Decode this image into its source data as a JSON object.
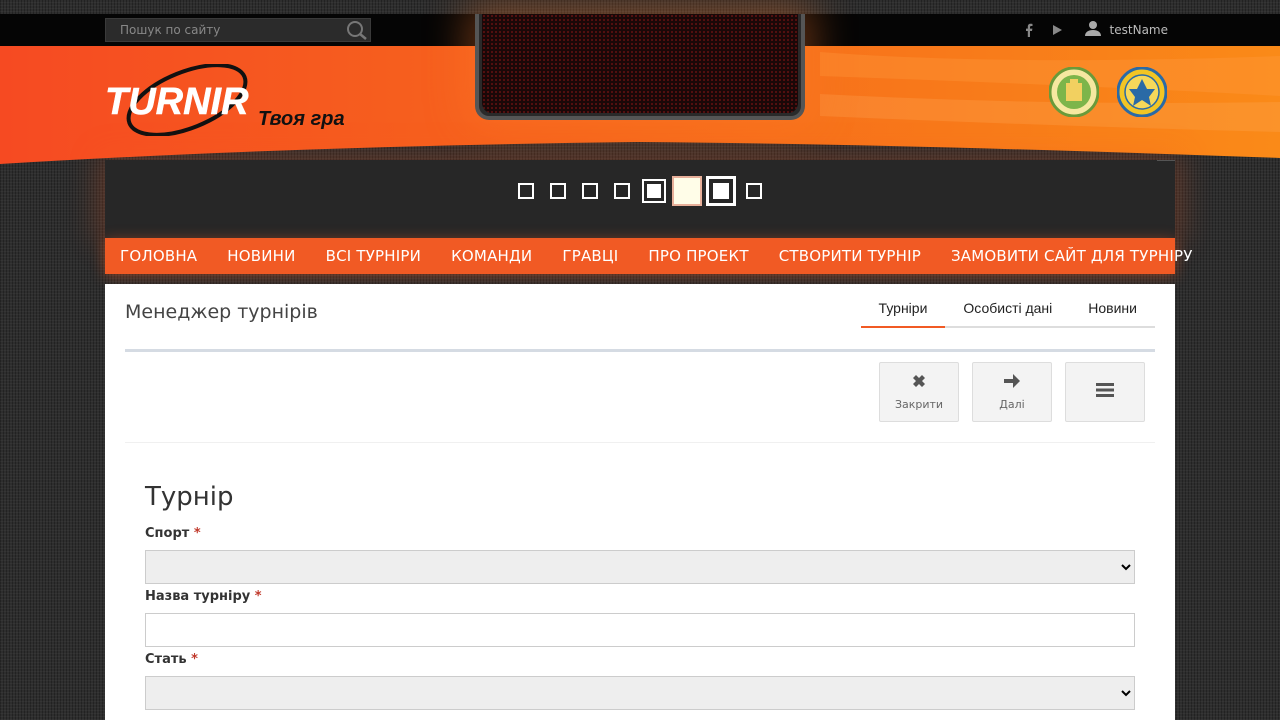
{
  "search": {
    "placeholder": "Пошук по сайту"
  },
  "user": {
    "name": "testName"
  },
  "brand": {
    "logo_text": "TURNIR",
    "tagline": "Твоя гра"
  },
  "colors": {
    "accent": "#f15a24",
    "dark": "#272727"
  },
  "nav": {
    "items": [
      {
        "label": "ГОЛОВНА"
      },
      {
        "label": "НОВИНИ"
      },
      {
        "label": "ВСІ ТУРНІРИ"
      },
      {
        "label": "КОМАНДИ"
      },
      {
        "label": "ГРАВЦІ"
      },
      {
        "label": "ПРО ПРОЕКТ"
      },
      {
        "label": "СТВОРИТИ ТУРНІР"
      },
      {
        "label": "ЗАМОВИТИ САЙТ ДЛЯ ТУРНІРУ"
      }
    ]
  },
  "page": {
    "title": "Менеджер турнірів",
    "tabs": [
      {
        "label": "Турніри",
        "active": true
      },
      {
        "label": "Особисті дані",
        "active": false
      },
      {
        "label": "Новини",
        "active": false
      }
    ]
  },
  "toolbar": {
    "close_label": "Закрити",
    "next_label": "Далі"
  },
  "form": {
    "title": "Турнір",
    "fields": [
      {
        "label": "Спорт",
        "type": "select",
        "value": ""
      },
      {
        "label": "Назва турніру",
        "type": "text",
        "value": ""
      },
      {
        "label": "Стать",
        "type": "select",
        "value": ""
      }
    ],
    "required_mark": "*"
  }
}
